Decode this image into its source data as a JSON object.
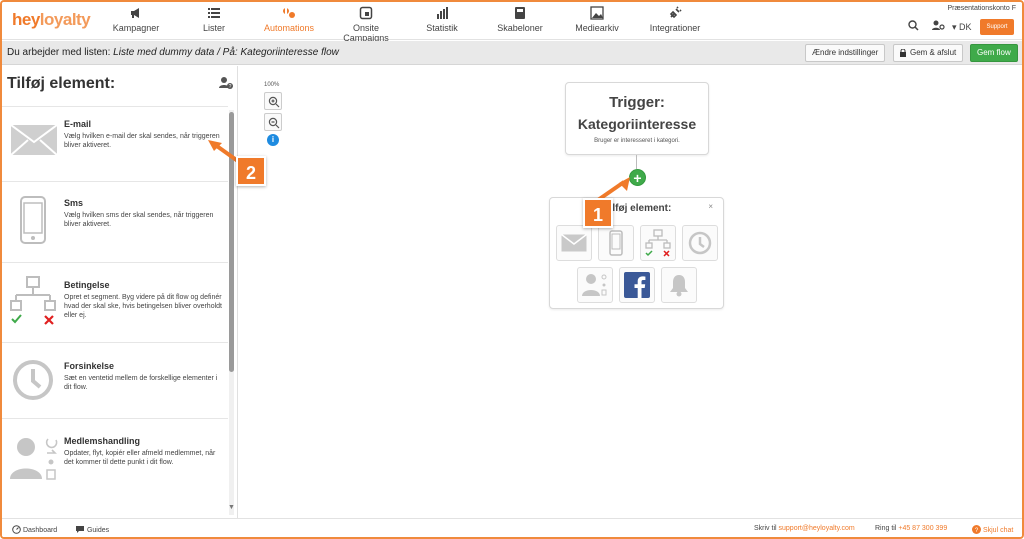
{
  "brand": {
    "hey": "hey",
    "loyalty": "loyalty",
    "accent": "#f07a2a"
  },
  "nav": {
    "items": [
      {
        "label": "Kampagner",
        "icon": "megaphone-icon"
      },
      {
        "label": "Lister",
        "icon": "list-icon"
      },
      {
        "label": "Automations",
        "icon": "automation-icon",
        "active": true
      },
      {
        "label": "Onsite Campaigns",
        "icon": "window-icon"
      },
      {
        "label": "Statistik",
        "icon": "bar-chart-icon"
      },
      {
        "label": "Skabeloner",
        "icon": "template-icon"
      },
      {
        "label": "Mediearkiv",
        "icon": "image-icon"
      },
      {
        "label": "Integrationer",
        "icon": "plug-icon"
      }
    ],
    "account_label": "Præsentationskonto F",
    "language": "DK",
    "support_label": "Support"
  },
  "subbar": {
    "prefix": "Du arbejder med listen: ",
    "list_name": "Liste med dummy data",
    "separator": " / På: ",
    "flow_name": "Kategoriinteresse flow",
    "btn_settings": "Ændre indstillinger",
    "btn_save_exit": "Gem & afslut",
    "btn_save_flow": "Gem flow"
  },
  "left_panel": {
    "title": "Tilføj element:",
    "elements": [
      {
        "name": "E-mail",
        "desc": "Vælg hvilken e-mail der skal sendes, når triggeren bliver aktiveret."
      },
      {
        "name": "Sms",
        "desc": "Vælg hvilken sms der skal sendes, når triggeren bliver aktiveret."
      },
      {
        "name": "Betingelse",
        "desc": "Opret et segment. Byg videre på dit flow og definér hvad der skal ske, hvis betingelsen bliver overholdt eller ej."
      },
      {
        "name": "Forsinkelse",
        "desc": "Sæt en ventetid mellem de forskellige elementer i dit flow."
      },
      {
        "name": "Medlemshandling",
        "desc": "Opdater, flyt, kopiér eller afmeld medlemmet, når det kommer til dette punkt i dit flow."
      }
    ]
  },
  "canvas": {
    "zoom": "100%",
    "trigger": {
      "title1": "Trigger:",
      "title2": "Kategoriinteresse",
      "desc": "Bruger er interesseret i kategori."
    },
    "add_box": {
      "title": "Tilføj element:",
      "close": "×"
    },
    "callouts": {
      "one": "1",
      "two": "2"
    }
  },
  "footer": {
    "dashboard": "Dashboard",
    "guides": "Guides",
    "write_to": "Skriv til",
    "email": "support@heyloyalty.com",
    "call": "Ring til",
    "phone": "+45 87 300 399",
    "hide_chat": "Skjul chat"
  }
}
